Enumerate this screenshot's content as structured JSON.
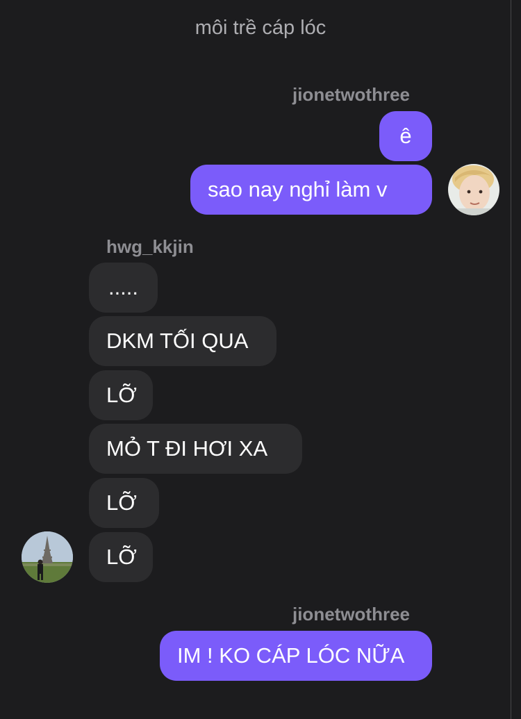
{
  "header": {
    "title": "môi trề cáp lóc"
  },
  "groups": [
    {
      "sender": "jionetwothree",
      "direction": "outgoing",
      "messages": [
        "ê",
        "sao nay nghỉ làm v"
      ]
    },
    {
      "sender": "hwg_kkjin",
      "direction": "incoming",
      "messages": [
        ".....",
        "DKM TỐI QUA",
        "LỠ",
        "MỎ T ĐI HƠI XA",
        "LỠ",
        "LỠ"
      ]
    },
    {
      "sender": "jionetwothree",
      "direction": "outgoing",
      "messages": [
        "IM ! KO CÁP LÓC NỮA"
      ]
    }
  ],
  "colors": {
    "background": "#1c1c1e",
    "outgoing_bubble": "#7b5cfa",
    "incoming_bubble": "#2c2c2e",
    "sender_name": "#8e8e93",
    "title": "#aeaeb2"
  }
}
